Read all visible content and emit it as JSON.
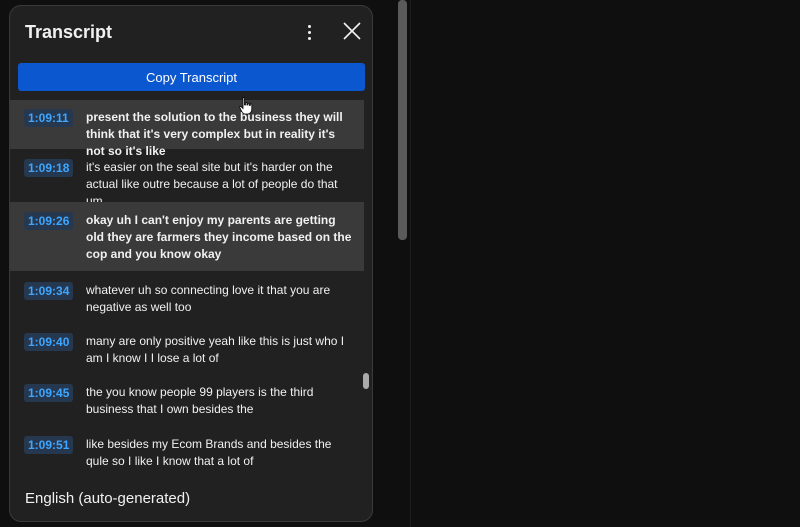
{
  "panel": {
    "title": "Transcript",
    "copy_label": "Copy Transcript",
    "footer_language": "English (auto-generated)"
  },
  "segments": [
    {
      "time": "1:09:11",
      "text": "present the solution to the business they will think that it's very complex but in reality it's not so it's like",
      "highlighted": true
    },
    {
      "time": "1:09:18",
      "text": "it's easier on the seal site but it's harder on the actual like outre because a lot of people do that um",
      "highlighted": false
    },
    {
      "time": "1:09:26",
      "text": "okay uh I can't enjoy my parents are getting old they are farmers they income based on the cop and you know okay",
      "highlighted": true
    },
    {
      "time": "1:09:34",
      "text": "whatever uh so connecting love it that you are negative as well too",
      "highlighted": false
    },
    {
      "time": "1:09:40",
      "text": "many are only positive yeah like this is just who I am I know I I lose a lot of",
      "highlighted": false
    },
    {
      "time": "1:09:45",
      "text": "the you know people 99 players is the third business that I own besides the",
      "highlighted": false
    },
    {
      "time": "1:09:51",
      "text": "like besides my Ecom Brands and besides the qule so I like I know that a lot of",
      "highlighted": false
    }
  ],
  "icons": {
    "more": "more-vertical-icon",
    "close": "close-icon",
    "cursor": "hand-pointer-icon"
  },
  "colors": {
    "panel_bg": "#212121",
    "accent_button": "#0b57d0",
    "timestamp_text": "#3ea6ff",
    "timestamp_bg": "#263850",
    "highlight_row": "#3a3a3a"
  }
}
